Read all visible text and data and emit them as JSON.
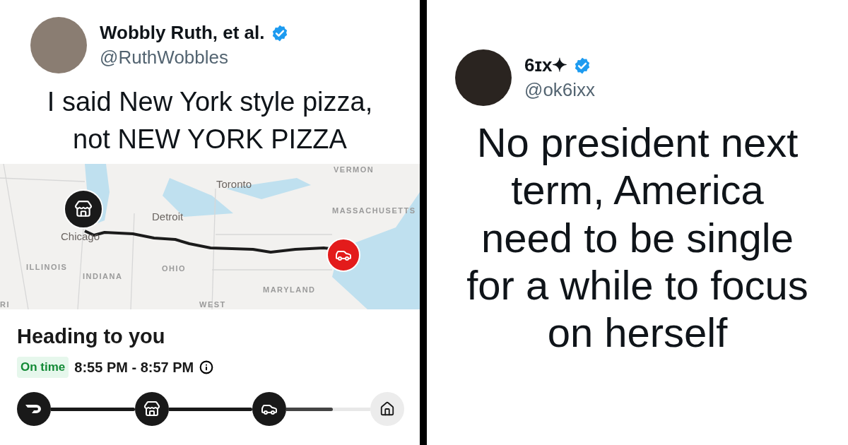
{
  "left_post": {
    "author": {
      "name": "Wobbly Ruth, et al.",
      "handle": "@RuthWobbles",
      "verified": true
    },
    "text": "I said New York style pizza, not NEW YORK PIZZA",
    "map": {
      "labels": [
        "VERMON",
        "Toronto",
        "MASSACHUSETTS",
        "Detroit",
        "Chicago",
        "ILLINOIS",
        "INDIANA",
        "OHIO",
        "MARYLAND",
        "WEST",
        "RI"
      ]
    },
    "order_card": {
      "title": "Heading to you",
      "status_badge": "On time",
      "eta": "8:55 PM - 8:57 PM",
      "steps": [
        {
          "kind": "dasher",
          "done": true
        },
        {
          "kind": "store",
          "done": true
        },
        {
          "kind": "car",
          "done": true
        },
        {
          "kind": "home",
          "done": false
        }
      ],
      "segments": [
        {
          "level": 1
        },
        {
          "level": 1
        },
        {
          "level": 0.55
        }
      ]
    }
  },
  "right_post": {
    "author": {
      "name": "6ɪx✦",
      "handle": "@ok6ixx",
      "verified": true
    },
    "text": "No president next term, America need to be single for a while to focus on herself"
  }
}
